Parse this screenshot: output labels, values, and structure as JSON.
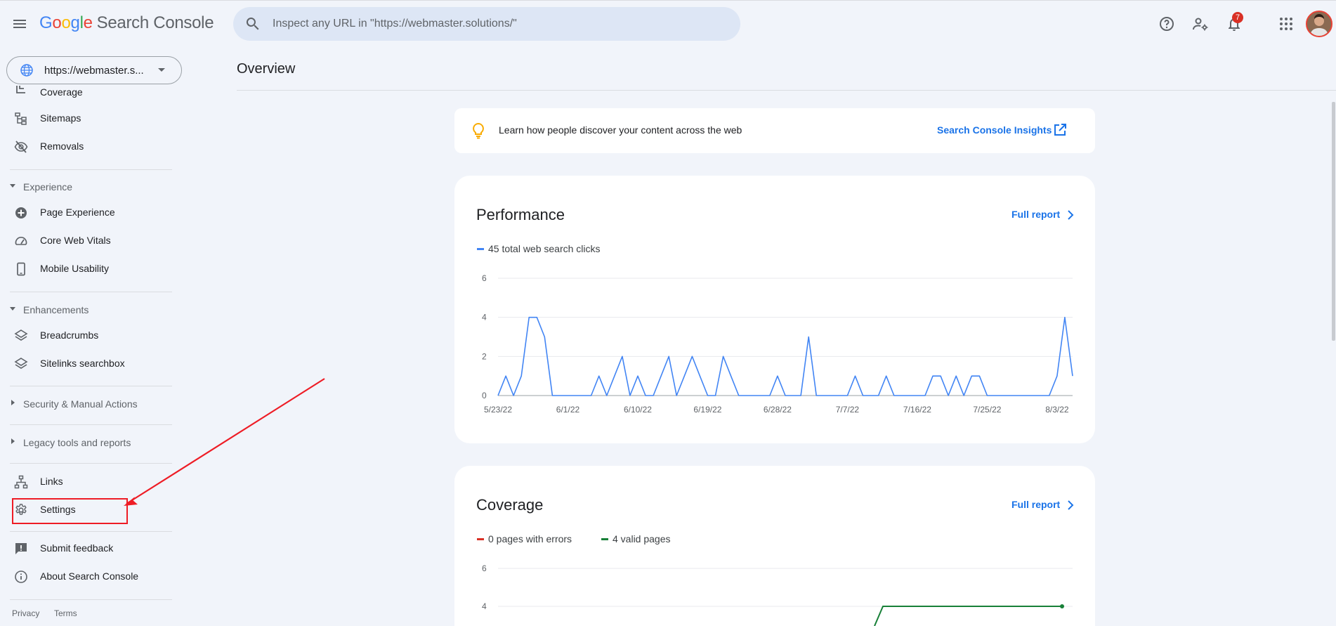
{
  "header": {
    "logo_letters": [
      {
        "ch": "G",
        "color": "#4285f4"
      },
      {
        "ch": "o",
        "color": "#ea4335"
      },
      {
        "ch": "o",
        "color": "#fbbc05"
      },
      {
        "ch": "g",
        "color": "#4285f4"
      },
      {
        "ch": "l",
        "color": "#34a853"
      },
      {
        "ch": "e",
        "color": "#ea4335"
      }
    ],
    "product": "Search Console",
    "search_placeholder": "Inspect any URL in \"https://webmaster.solutions/\"",
    "notifications_count": "7",
    "icons": [
      "menu-icon",
      "search-icon",
      "help-icon",
      "manage-users-icon",
      "notifications-icon",
      "apps-icon"
    ]
  },
  "sidebar": {
    "property": "https://webmaster.s...",
    "items_top": [
      {
        "label": "Coverage",
        "icon": "coverage-icon"
      },
      {
        "label": "Sitemaps",
        "icon": "sitemaps-icon"
      },
      {
        "label": "Removals",
        "icon": "removals-icon"
      }
    ],
    "experience": {
      "label": "Experience",
      "items": [
        {
          "label": "Page Experience",
          "icon": "page-experience-icon"
        },
        {
          "label": "Core Web Vitals",
          "icon": "gauge-icon"
        },
        {
          "label": "Mobile Usability",
          "icon": "mobile-icon"
        }
      ]
    },
    "enhancements": {
      "label": "Enhancements",
      "items": [
        {
          "label": "Breadcrumbs",
          "icon": "layers-icon"
        },
        {
          "label": "Sitelinks searchbox",
          "icon": "layers-icon"
        }
      ]
    },
    "security": "Security & Manual Actions",
    "legacy": "Legacy tools and reports",
    "links": "Links",
    "settings": "Settings",
    "feedback": "Submit feedback",
    "about": "About Search Console",
    "privacy": "Privacy",
    "terms": "Terms"
  },
  "main": {
    "title": "Overview",
    "insight": {
      "message": "Learn how people discover your content across the web",
      "link": "Search Console Insights"
    },
    "performance": {
      "title": "Performance",
      "full_report": "Full report",
      "legend": "45 total web search clicks"
    },
    "coverage": {
      "title": "Coverage",
      "full_report": "Full report",
      "legend_errors": "0 pages with errors",
      "legend_valid": "4 valid pages"
    }
  },
  "colors": {
    "accent": "#1a73e8",
    "clicks_line": "#4285f4",
    "errors": "#d93025",
    "valid": "#188038",
    "annotation": "#ee1c25"
  },
  "chart_data": [
    {
      "type": "line",
      "ylim": [
        0,
        6
      ],
      "yticks": [
        0,
        2,
        4,
        6
      ],
      "xtick_labels": [
        "5/23/22",
        "6/1/22",
        "6/10/22",
        "6/19/22",
        "6/28/22",
        "7/7/22",
        "7/16/22",
        "7/25/22",
        "8/3/22"
      ],
      "x": [
        "5/23/22",
        "5/24/22",
        "5/25/22",
        "5/26/22",
        "5/27/22",
        "5/28/22",
        "5/29/22",
        "5/30/22",
        "5/31/22",
        "6/1/22",
        "6/2/22",
        "6/3/22",
        "6/4/22",
        "6/5/22",
        "6/6/22",
        "6/7/22",
        "6/8/22",
        "6/9/22",
        "6/10/22",
        "6/11/22",
        "6/12/22",
        "6/13/22",
        "6/14/22",
        "6/15/22",
        "6/16/22",
        "6/17/22",
        "6/18/22",
        "6/19/22",
        "6/20/22",
        "6/21/22",
        "6/22/22",
        "6/23/22",
        "6/24/22",
        "6/25/22",
        "6/26/22",
        "6/27/22",
        "6/28/22",
        "6/29/22",
        "6/30/22",
        "7/1/22",
        "7/2/22",
        "7/3/22",
        "7/4/22",
        "7/5/22",
        "7/6/22",
        "7/7/22",
        "7/8/22",
        "7/9/22",
        "7/10/22",
        "7/11/22",
        "7/12/22",
        "7/13/22",
        "7/14/22",
        "7/15/22",
        "7/16/22",
        "7/17/22",
        "7/18/22",
        "7/19/22",
        "7/20/22",
        "7/21/22",
        "7/22/22",
        "7/23/22",
        "7/24/22",
        "7/25/22",
        "7/26/22",
        "7/27/22",
        "7/28/22",
        "7/29/22",
        "7/30/22",
        "7/31/22",
        "8/1/22",
        "8/2/22",
        "8/3/22",
        "8/4/22"
      ],
      "series": [
        {
          "name": "45 total web search clicks",
          "values": [
            0,
            1,
            0,
            1,
            4,
            4,
            3,
            0,
            0,
            0,
            0,
            0,
            0,
            1,
            0,
            1,
            2,
            0,
            1,
            0,
            0,
            1,
            2,
            0,
            1,
            2,
            1,
            0,
            0,
            2,
            1,
            0,
            0,
            0,
            0,
            0,
            1,
            0,
            0,
            0,
            3,
            0,
            0,
            0,
            0,
            0,
            1,
            0,
            0,
            0,
            1,
            0,
            0,
            0,
            0,
            0,
            1,
            1,
            0,
            1,
            0,
            1,
            1,
            0,
            0,
            0,
            0,
            0,
            0,
            0,
            0,
            0,
            1,
            4,
            1
          ]
        }
      ]
    },
    {
      "type": "line",
      "ylim": [
        0,
        6
      ],
      "yticks": [
        4,
        6
      ],
      "series": [
        {
          "name": "4 valid pages",
          "values": [
            4
          ]
        }
      ]
    }
  ]
}
